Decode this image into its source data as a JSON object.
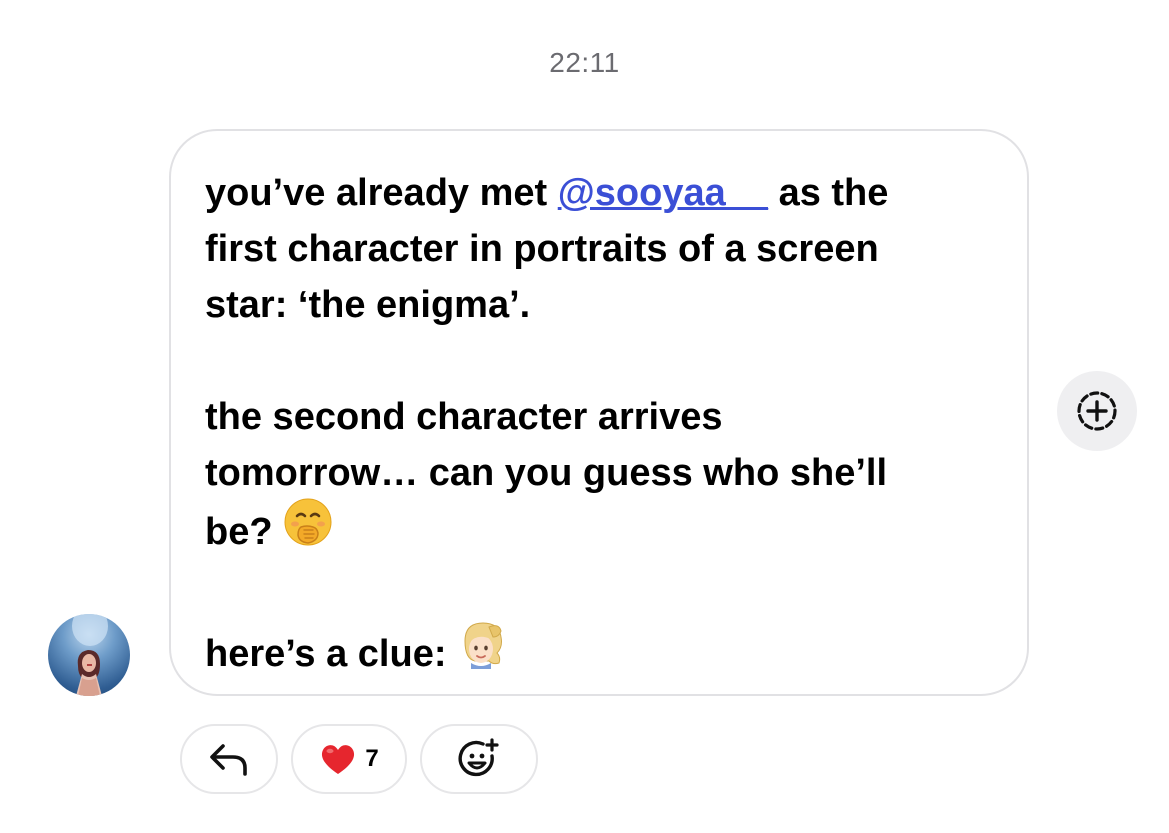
{
  "timestamp": "22:11",
  "message": {
    "line1_pre": "you’ve already met ",
    "mention": "@sooyaa__",
    "line1_post": " as the",
    "line2": "first character in portraits of a screen",
    "line3": "star: ‘the enigma’.",
    "line4": "the second character arrives",
    "line5": "tomorrow… can you guess who she’ll",
    "line6": "be?",
    "line7": "here’s a clue:"
  },
  "icons": {
    "avatar": "sender-avatar",
    "react_button": "add-reaction-icon",
    "reply": "reply-arrow-icon",
    "heart": "heart-icon",
    "add_emoji": "add-emoji-icon",
    "emoji_blush": "face-with-hand-over-mouth-emoji",
    "emoji_clue": "blonde-ponytail-person-emoji"
  },
  "reactions": {
    "heart_count": "7"
  },
  "colors": {
    "mention": "#3b4fd6",
    "heart": "#e6262e",
    "timestamp": "#6b6b70",
    "bubble_border": "#e1e1e4",
    "react_bg": "#efeff1"
  }
}
